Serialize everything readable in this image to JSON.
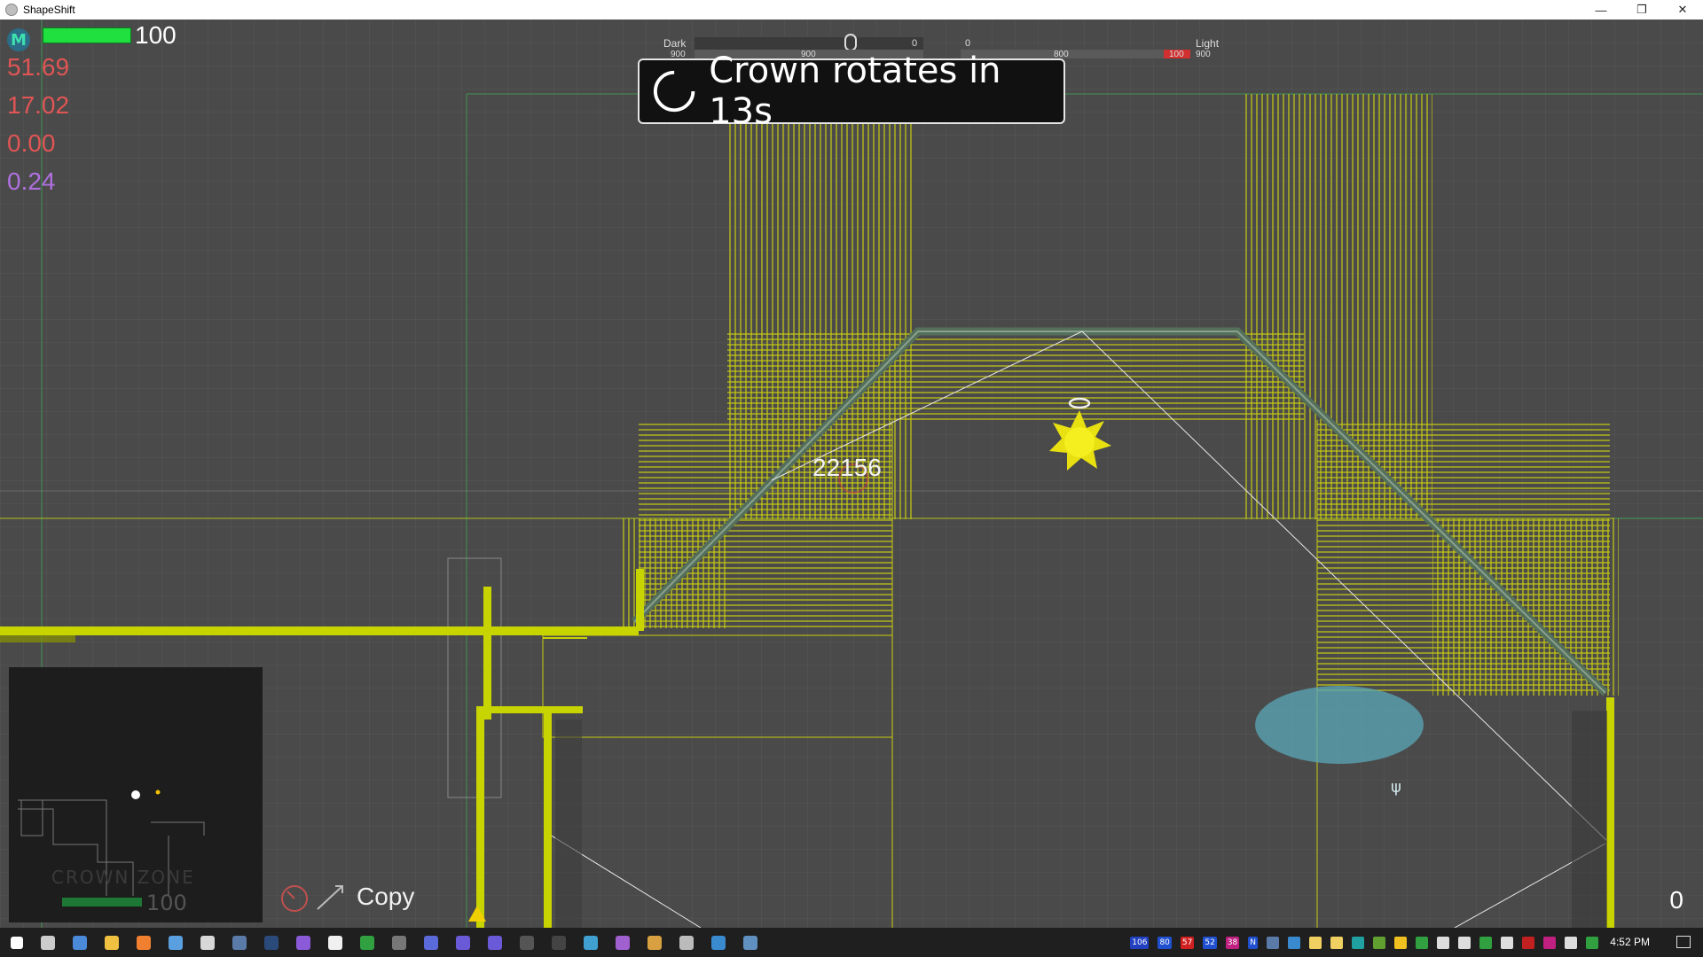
{
  "window": {
    "title": "ShapeShift"
  },
  "hud": {
    "health_value": "100",
    "health_fraction": 1.0,
    "stats": [
      {
        "value": "51.69",
        "color": "#e05555"
      },
      {
        "value": "17.02",
        "color": "#e05555"
      },
      {
        "value": "0.00",
        "color": "#e05555"
      },
      {
        "value": "0.24",
        "color": "#b070e0"
      }
    ],
    "balance": {
      "left_label": "Dark",
      "right_label": "Light",
      "dark_value": "0",
      "light_value": "0",
      "dark_bar_labels": [
        "900",
        "900"
      ],
      "light_bar_labels": [
        "800",
        "100",
        "900"
      ]
    },
    "banner_text": "Crown rotates in 13s",
    "floating_score": "22156",
    "copy_label": "Copy",
    "corner_value": "0",
    "minimap_health": "100",
    "minimap_zone": "CROWN ZONE"
  },
  "colors": {
    "background": "#4a4a4a",
    "wall_yellow": "#c8d400",
    "health_green": "#20e040",
    "water": "#5aa8b8"
  },
  "taskbar": {
    "time": "4:52 PM",
    "tray_badges": [
      "106",
      "80",
      "57",
      "52",
      "38",
      "N"
    ]
  }
}
